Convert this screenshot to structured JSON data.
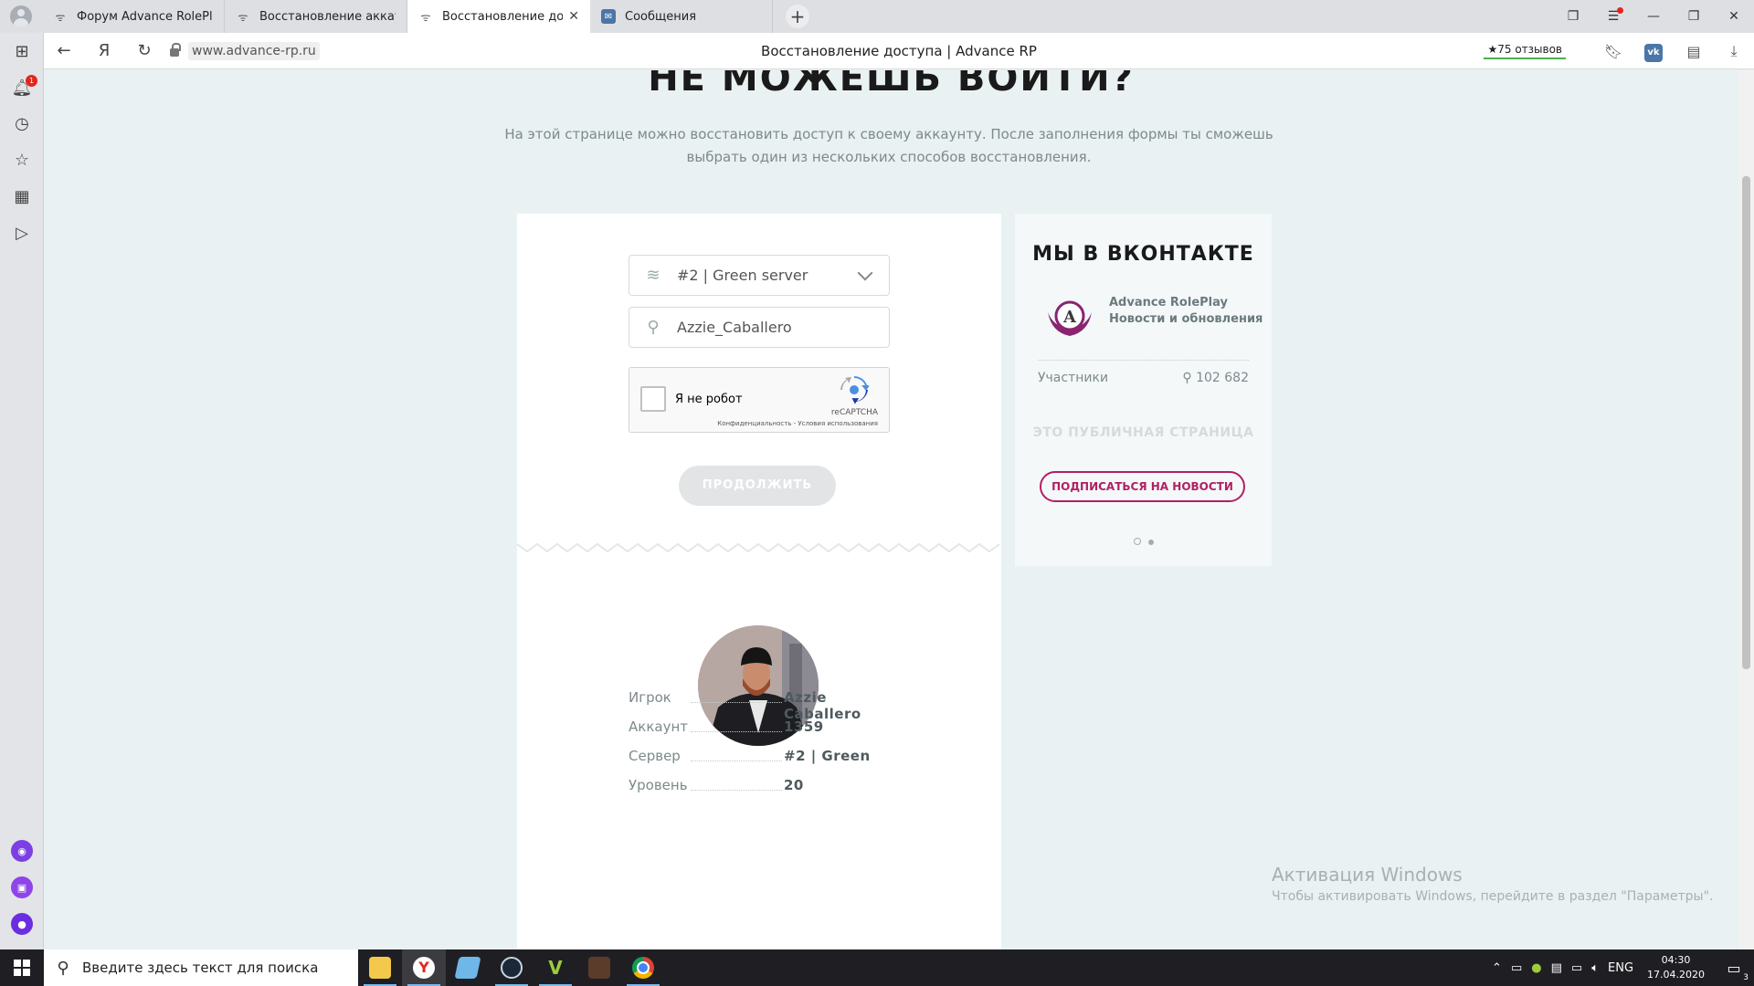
{
  "tabs": [
    {
      "title": "Форум Advance RolePlay",
      "active": false,
      "icon": "advance-icon"
    },
    {
      "title": "Восстановление аккаунто",
      "active": false,
      "icon": "advance-icon"
    },
    {
      "title": "Восстановление досту",
      "active": true,
      "icon": "advance-icon"
    },
    {
      "title": "Сообщения",
      "active": false,
      "icon": "vk-icon"
    }
  ],
  "browser": {
    "url": "www.advance-rp.ru",
    "page_title": "Восстановление доступа | Advance RP",
    "reviews": "★75 отзывов",
    "yandex_glyph": "Я",
    "vk_badge": "vk",
    "notification_count": "1"
  },
  "page": {
    "headline": "НЕ МОЖЕШЬ ВОЙТИ?",
    "intro": "На этой странице можно восстановить доступ к своему аккаунту. После заполнения формы ты сможешь выбрать один из нескольких способов восстановления.",
    "form": {
      "server_value": "#2 | Green server",
      "nickname_value": "Azzie_Caballero",
      "captcha_label": "Я не робот",
      "captcha_brand": "reCAPTCHA",
      "captcha_terms": "Конфиденциальность - Условия использования",
      "continue_label": "ПРОДОЛЖИТЬ"
    },
    "player": [
      {
        "label": "Игрок",
        "value": "Azzie Caballero"
      },
      {
        "label": "Аккаунт",
        "value": "1359"
      },
      {
        "label": "Сервер",
        "value": "#2 | Green"
      },
      {
        "label": "Уровень",
        "value": "20"
      }
    ],
    "vk": {
      "title": "МЫ В ВКОНТАКТЕ",
      "group_name": "Advance RolePlay",
      "group_desc": "Новости и обновления",
      "members_label": "Участники",
      "members_count": "102 682",
      "public_label": "ЭТО ПУБЛИЧНАЯ СТРАНИЦА",
      "subscribe_label": "ПОДПИСАТЬСЯ НА НОВОСТИ",
      "logo_letter": "A"
    },
    "windows_activation": {
      "title": "Активация Windows",
      "text": "Чтобы активировать Windows, перейдите в раздел \"Параметры\"."
    }
  },
  "taskbar": {
    "search_placeholder": "Введите здесь текст для поиска",
    "lang": "ENG",
    "time": "04:30",
    "date": "17.04.2020",
    "notif_count": "3"
  },
  "colors": {
    "accent": "#b21f62",
    "page_bg": "#e9f1f2",
    "vk_blue": "#4a76a8"
  }
}
